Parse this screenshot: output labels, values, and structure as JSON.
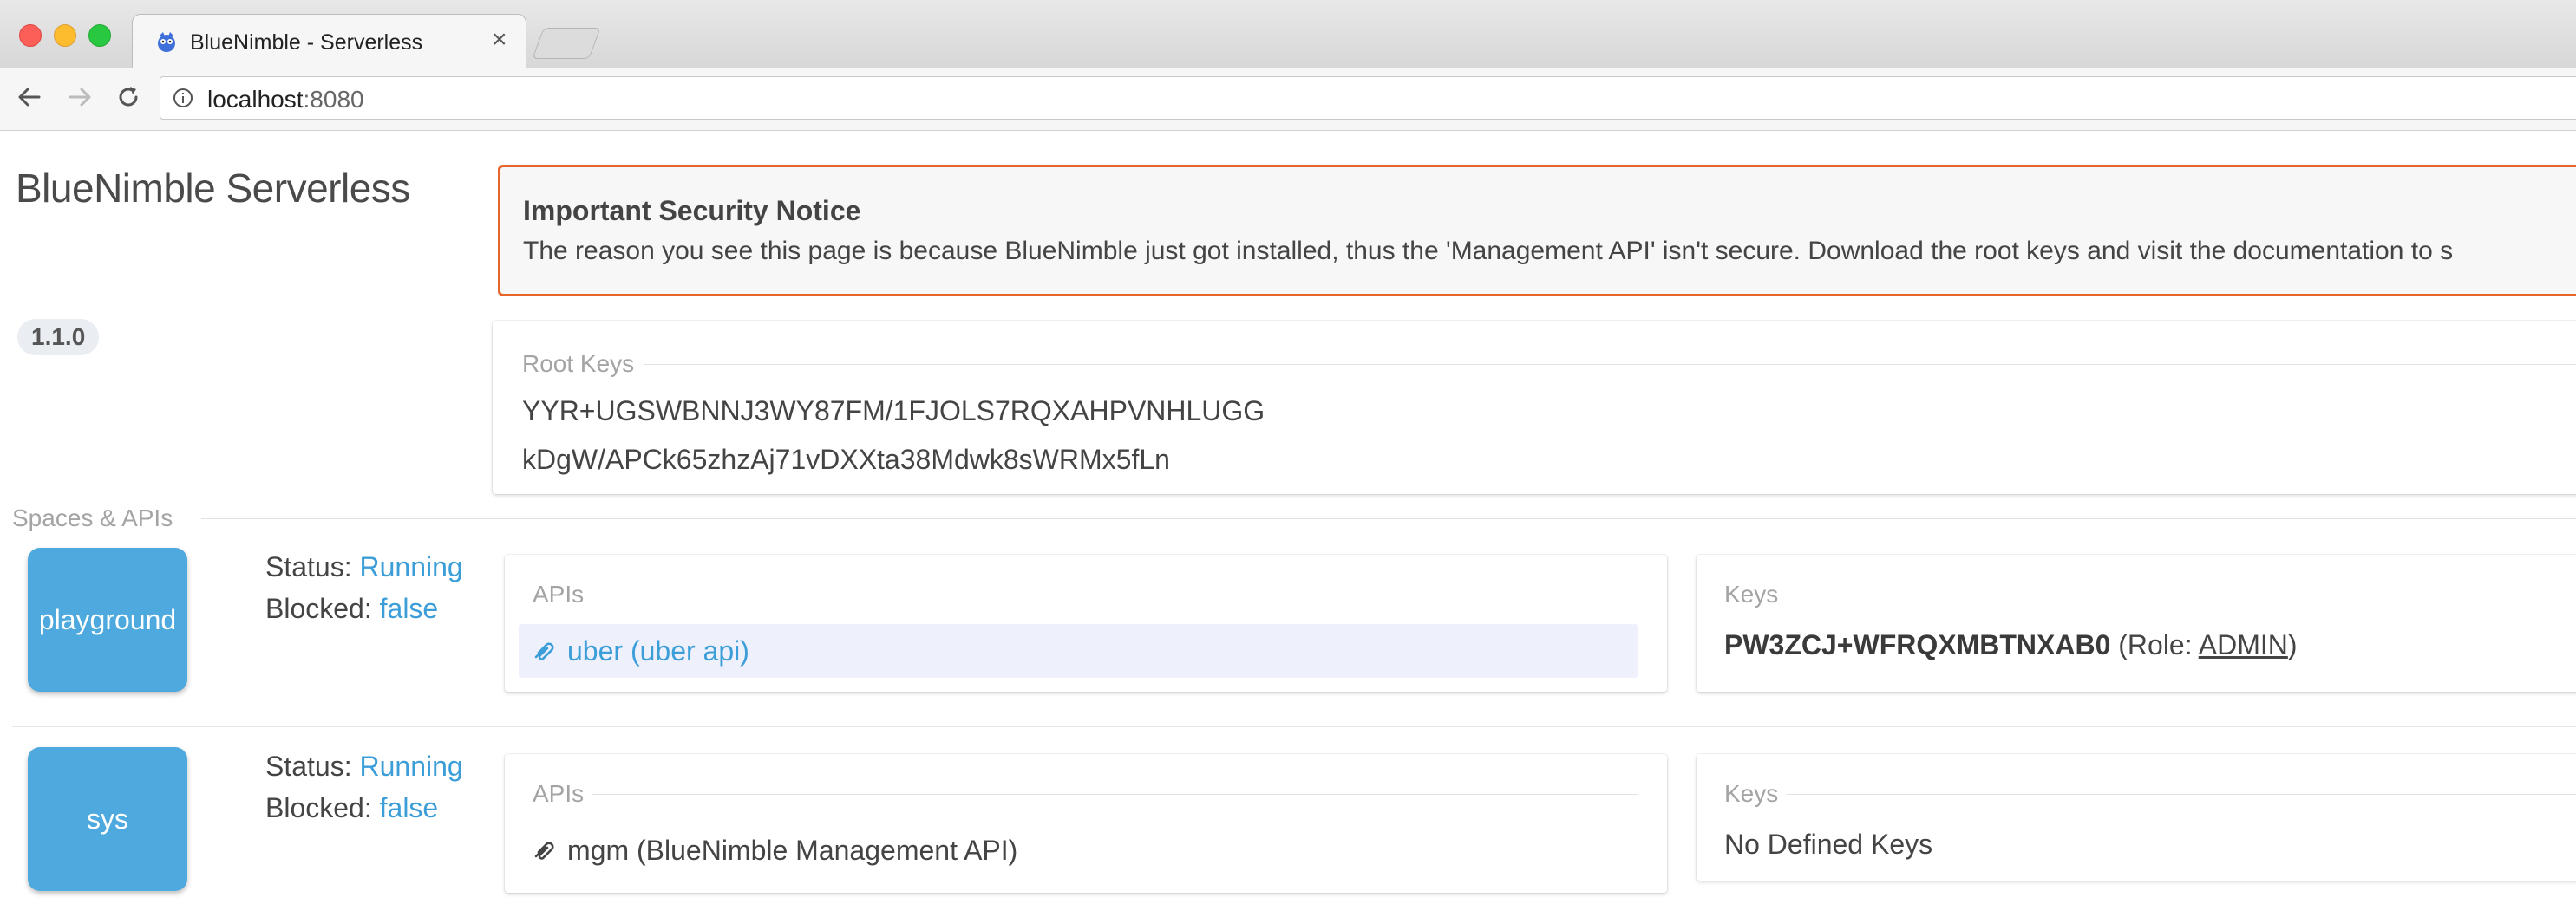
{
  "browser": {
    "tab_title": "BlueNimble - Serverless",
    "tab_close": "×",
    "url_host": "localhost",
    "url_port": ":8080"
  },
  "app": {
    "brand": "BlueNimble Serverless",
    "version": "1.1.0"
  },
  "notice": {
    "title": "Important Security Notice",
    "body": "The reason you see this page is because BlueNimble just got installed, thus the 'Management API' isn't secure. Download the root keys and visit the documentation to s"
  },
  "root_keys": {
    "legend": "Root Keys",
    "keys": [
      "YYR+UGSWBNNJ3WY87FM/1FJOLS7RQXAHPVNHLUGG",
      "kDgW/APCk65zhzAj71vDXXta38Mdwk8sWRMx5fLn"
    ]
  },
  "spaces": {
    "legend": "Spaces & APIs",
    "status_label": "Status:",
    "blocked_label": "Blocked:",
    "apis_legend": "APIs",
    "keys_legend": "Keys",
    "items": [
      {
        "name": "playground",
        "status": "Running",
        "blocked": "false",
        "apis": [
          "uber (uber api)"
        ],
        "key": {
          "value": "PW3ZCJ+WFRQXMBTNXAB0",
          "role_prefix": " (Role: ",
          "role": "ADMIN",
          "role_suffix": ")"
        }
      },
      {
        "name": "sys",
        "status": "Running",
        "blocked": "false",
        "apis": [
          "mgm (BlueNimble Management API)"
        ],
        "no_keys": "No Defined Keys"
      }
    ]
  },
  "colors": {
    "accent": "#3c9ed8",
    "tile": "#4eaade",
    "notice_border": "#e6652b"
  }
}
